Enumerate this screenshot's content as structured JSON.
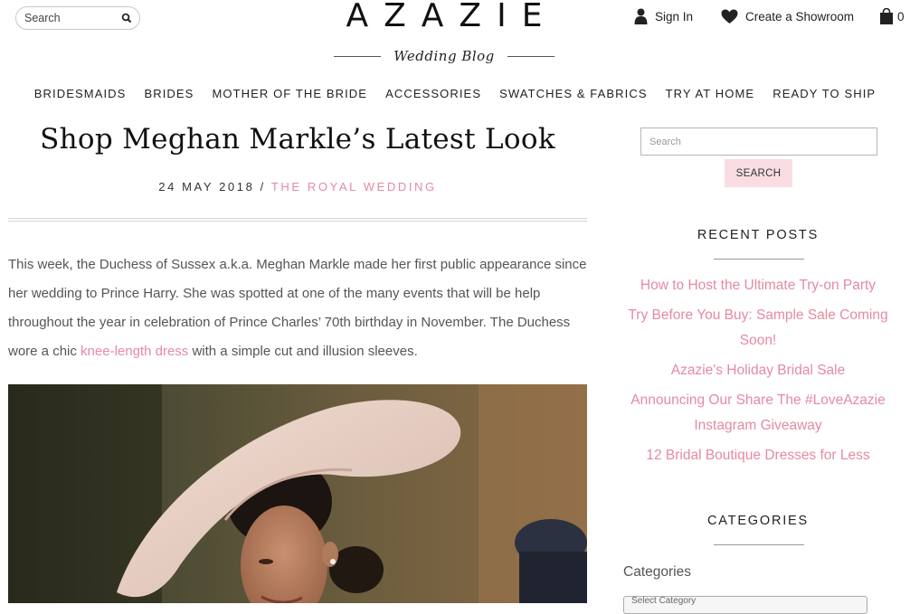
{
  "header": {
    "search_placeholder": "Search",
    "logo": "AZAZIE",
    "logo_subtitle": "Wedding Blog",
    "sign_in": "Sign In",
    "create_showroom": "Create a Showroom",
    "cart_count": "0"
  },
  "nav": {
    "items": [
      "BRIDESMAIDS",
      "BRIDES",
      "MOTHER OF THE BRIDE",
      "ACCESSORIES",
      "SWATCHES & FABRICS",
      "TRY AT HOME",
      "READY TO SHIP"
    ]
  },
  "article": {
    "title": "Shop Meghan Markle’s Latest Look",
    "date": "24 MAY 2018",
    "separator": "/",
    "category": "THE ROYAL WEDDING",
    "body_before_link": "This week, the Duchess of Sussex a.k.a. Meghan Markle made her first public appearance since her wedding to Prince Harry. She was spotted at one of the many events that will be help throughout the year in celebration of Prince Charles’ 70th birthday in November. The Duchess wore a chic ",
    "body_link": "knee-length dress",
    "body_after_link": " with a simple cut and illusion sleeves."
  },
  "sidebar": {
    "search_placeholder": "Search",
    "search_button": "SEARCH",
    "recent_posts_title": "RECENT POSTS",
    "recent_posts": [
      "How to Host the Ultimate Try-on Party",
      "Try Before You Buy: Sample Sale Coming Soon!",
      "Azazie's Holiday Bridal Sale",
      "Announcing Our Share The #LoveAzazie Instagram Giveaway",
      "12 Bridal Boutique Dresses for Less"
    ],
    "categories_title": "CATEGORIES",
    "categories_label": "Categories",
    "categories_select": "Select Category"
  },
  "colors": {
    "accent_pink": "#e58aa1",
    "button_pink": "#f9dde3"
  }
}
